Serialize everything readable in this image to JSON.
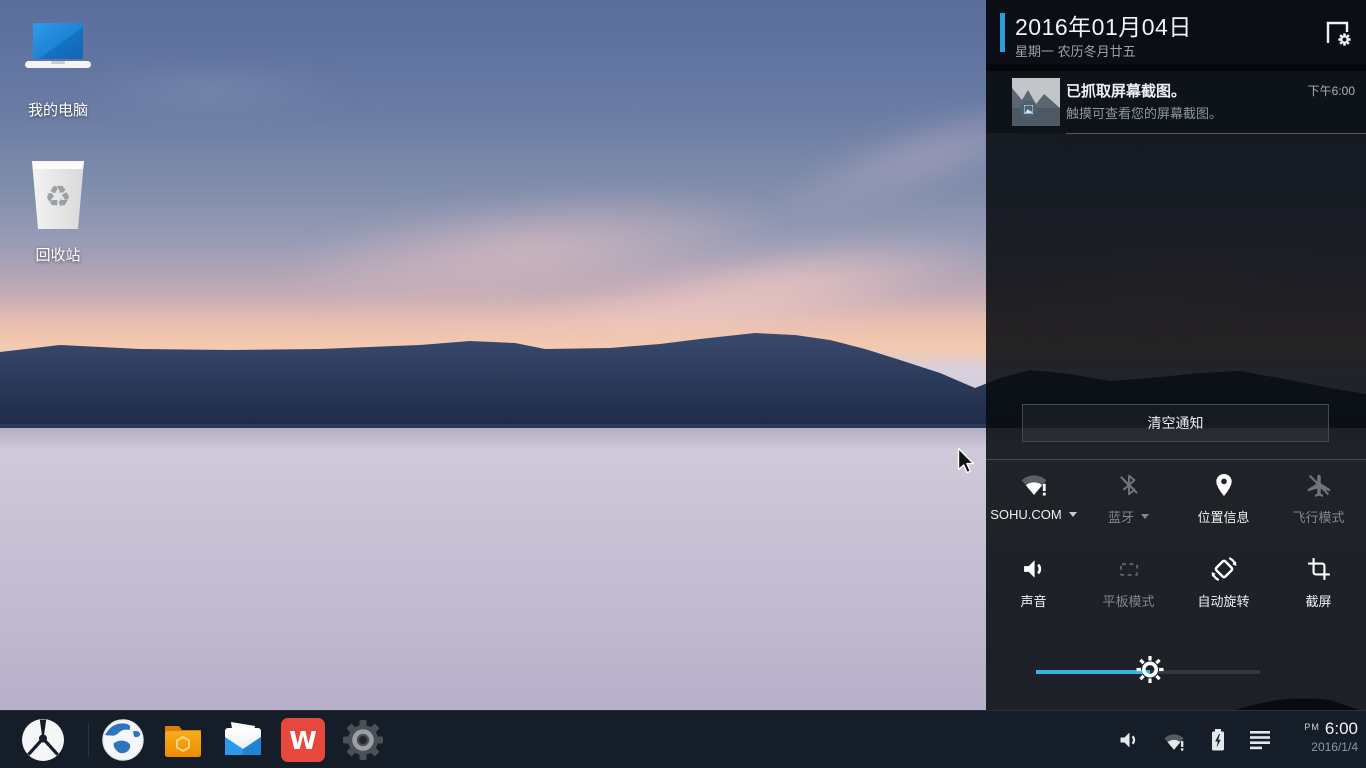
{
  "desktop": {
    "icons": [
      {
        "label": "我的电脑"
      },
      {
        "label": "回收站"
      }
    ]
  },
  "notification_panel": {
    "date": "2016年01月04日",
    "date_sub": "星期一 农历冬月廿五",
    "notifications": [
      {
        "title": "已抓取屏幕截图。",
        "body": "触摸可查看您的屏幕截图。",
        "time": "下午6:00"
      }
    ],
    "clear_button": "清空通知",
    "quick_settings": {
      "tiles": [
        {
          "label": "SOHU.COM",
          "icon": "wifi-alert-icon",
          "state": "on",
          "caret": true
        },
        {
          "label": "蓝牙",
          "icon": "bluetooth-off-icon",
          "state": "off",
          "caret": true
        },
        {
          "label": "位置信息",
          "icon": "location-icon",
          "state": "on",
          "caret": false
        },
        {
          "label": "飞行模式",
          "icon": "airplane-off-icon",
          "state": "off",
          "caret": false
        },
        {
          "label": "声音",
          "icon": "volume-icon",
          "state": "on",
          "caret": false
        },
        {
          "label": "平板模式",
          "icon": "tablet-mode-icon",
          "state": "off",
          "caret": false
        },
        {
          "label": "自动旋转",
          "icon": "auto-rotate-icon",
          "state": "on",
          "caret": false
        },
        {
          "label": "截屏",
          "icon": "screenshot-icon",
          "state": "on",
          "caret": false
        }
      ],
      "brightness_percent": 51
    }
  },
  "taskbar": {
    "apps": [
      "start-menu",
      "browser",
      "file-manager",
      "mail",
      "wps-office",
      "settings"
    ],
    "tray_icons": [
      "volume",
      "wifi-alert",
      "battery-charging",
      "notification-lines"
    ],
    "clock": {
      "meridiem": "PM",
      "time": "6:00",
      "date": "2016/1/4"
    }
  },
  "colors": {
    "accent_blue": "#2d9fd8",
    "slider_blue": "#33b5e5",
    "taskbar_bg": "#141d28",
    "panel_scrim": "rgba(8,11,16,0.88)"
  }
}
